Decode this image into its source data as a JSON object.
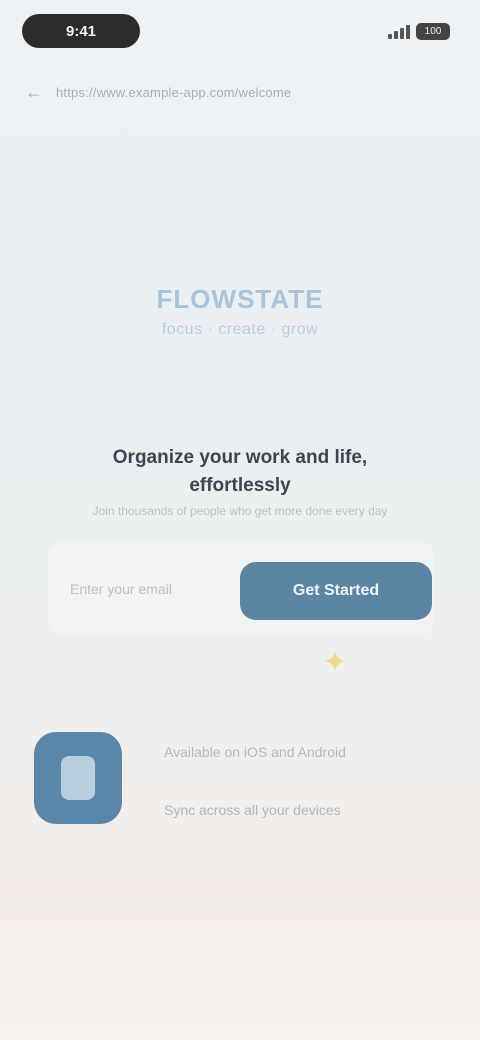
{
  "status_bar": {
    "time": "9:41",
    "battery": "100"
  },
  "browser": {
    "back_glyph": "←",
    "url": "https://www.example-app.com/welcome"
  },
  "brand": {
    "name": "FLOWSTATE",
    "tagline": "focus · create · grow"
  },
  "hero": {
    "headline": "Organize your work and life, effortlessly",
    "subline": "Join thousands of people who get more done every day"
  },
  "signup": {
    "email_placeholder": "Enter your email",
    "email_value": "",
    "button_label": "Get Started"
  },
  "decor": {
    "sparkle_glyph": "✦",
    "accent_color": "#5c85a4"
  },
  "feature": {
    "icon": "phone-app-icon",
    "line1": "Available on iOS and Android",
    "line2": "Sync across all your devices"
  }
}
